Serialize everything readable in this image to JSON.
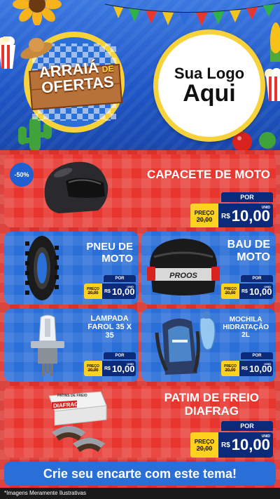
{
  "header": {
    "badge_line1": "ARRAIÁ",
    "badge_de": "DE",
    "badge_line2": "OFERTAS",
    "logo_line1": "Sua Logo",
    "logo_line2": "Aqui"
  },
  "products": [
    {
      "name": "CAPACETE DE MOTO",
      "discount": "-50%",
      "por": "POR",
      "preco_label": "PREÇO",
      "old_price": "20,00",
      "currency": "R$",
      "price": "10,00",
      "unit": "UNID"
    },
    {
      "name_l1": "PNEU DE",
      "name_l2": "MOTO",
      "por": "POR",
      "preco_label": "PREÇO",
      "old_price": "20,00",
      "currency": "R$",
      "price": "10,00",
      "unit": "UNID"
    },
    {
      "name_l1": "BAU DE",
      "name_l2": "MOTO",
      "por": "POR",
      "preco_label": "PREÇO",
      "old_price": "20,00",
      "currency": "R$",
      "price": "10,00",
      "unit": "UNID",
      "case_text": "PROOS"
    },
    {
      "name_l1": "LAMPADA",
      "name_l2": "FAROL 35 X",
      "name_l3": "35",
      "por": "POR",
      "preco_label": "PREÇO",
      "old_price": "20,00",
      "currency": "R$",
      "price": "10,00",
      "unit": "UNID"
    },
    {
      "name_l1": "MOCHILA",
      "name_l2": "HIDRATAÇÃO",
      "name_l3": "2L",
      "por": "POR",
      "preco_label": "PREÇO",
      "old_price": "20,00",
      "currency": "R$",
      "price": "10,00",
      "unit": "UNID"
    },
    {
      "name_l1": "PATIM DE FREIO",
      "name_l2": "DIAFRAG",
      "por": "POR",
      "preco_label": "PREÇO",
      "old_price": "20,00",
      "currency": "R$",
      "price": "10,00",
      "unit": "UNID",
      "box_brand": "DIAFRAG",
      "box_label": "PATINS DE FREIO"
    }
  ],
  "cta": "Crie seu encarte com este tema!",
  "disclaimer": "*Imagens Meramente Ilustrativas",
  "colors": {
    "red": "#e8362f",
    "blue": "#2a6fd8",
    "navy": "#0c2a7a",
    "yellow": "#ffd21f"
  }
}
